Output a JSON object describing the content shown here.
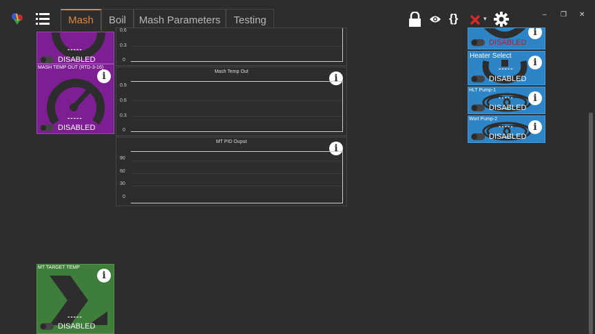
{
  "header": {
    "tabs": [
      {
        "label": "Mash",
        "active": true
      },
      {
        "label": "Boil",
        "active": false
      },
      {
        "label": "Mash Parameters",
        "active": false
      },
      {
        "label": "Testing",
        "active": false
      }
    ],
    "icons": [
      "app-logo-icon",
      "menu-icon",
      "lock-icon",
      "eye-icon",
      "braces-icon",
      "close-x-icon",
      "gear-icon"
    ],
    "window_controls": {
      "minimize": "–",
      "restore": "❐",
      "close": "✕"
    }
  },
  "left_widgets": {
    "top_partial": {
      "value": "-----",
      "state": "DISABLED"
    },
    "mash_temp_out": {
      "title": "MASH TEMP OUT (RTD-3-16)",
      "value": "-----",
      "state": "DISABLED"
    },
    "mt_target_temp": {
      "title": "MT TARGET TEMP",
      "value": "-----",
      "state": "DISABLED"
    }
  },
  "charts": [
    {
      "title": "",
      "ticks": [
        "0.6",
        "0.3",
        "0"
      ]
    },
    {
      "title": "Mash Temp Out",
      "ticks": [
        "0.9",
        "0.6",
        "0.3",
        "0"
      ]
    },
    {
      "title": "MT PID Ouput",
      "ticks": [
        "90",
        "60",
        "30",
        "0"
      ]
    }
  ],
  "right_widgets": {
    "top_partial": {
      "state": "DISABLED"
    },
    "heater_select": {
      "title": "Heater Select",
      "value": "-----",
      "state": "DISABLED"
    },
    "hlt_pump": {
      "title": "HLT Pump-1",
      "value": "-----",
      "state": "DISABLED"
    },
    "wort_pump": {
      "title": "Wort Pump-2",
      "value": "-----",
      "state": "DISABLED"
    }
  },
  "colors": {
    "accent": "#e2863d",
    "purple": "#7d1e93",
    "green": "#3f7d3a",
    "blue": "#2d84c6",
    "disabled_red": "#b3202a"
  }
}
